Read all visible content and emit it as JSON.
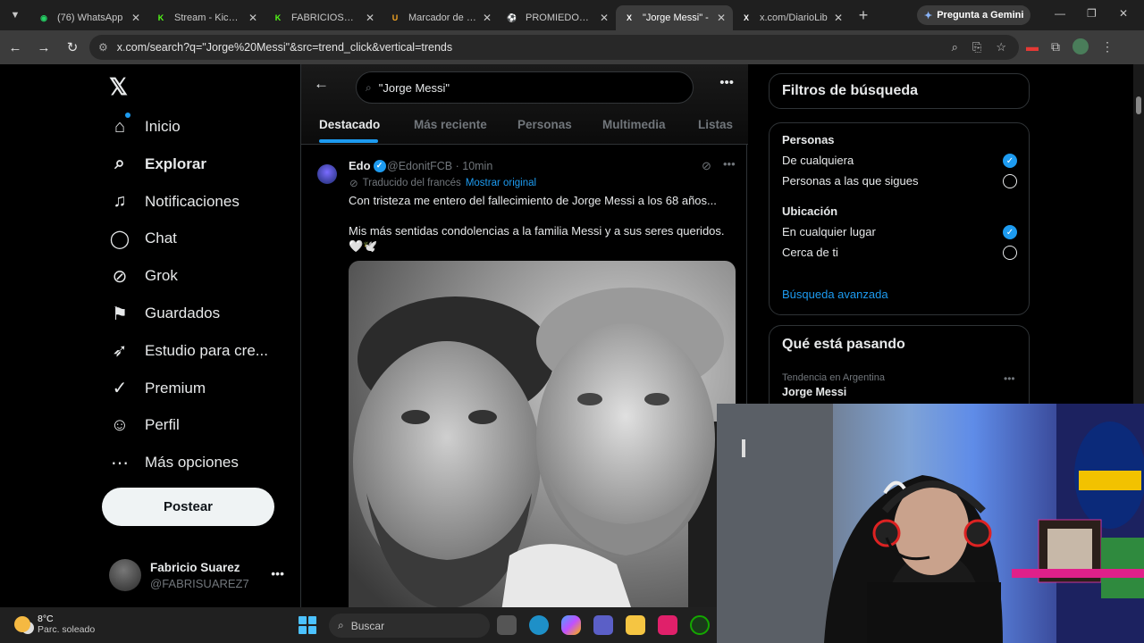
{
  "browser": {
    "tabs": [
      {
        "title": "(76) WhatsApp",
        "color": "#25d366",
        "glyph": "◉"
      },
      {
        "title": "Stream - Kick Da",
        "color": "#53fc18",
        "glyph": "K"
      },
      {
        "title": "FABRICIOSUARE",
        "color": "#53fc18",
        "glyph": "K"
      },
      {
        "title": "Marcador de lar",
        "color": "#f5a623",
        "glyph": "U"
      },
      {
        "title": "PROMIEDOS - F",
        "color": "#2ecc40",
        "glyph": "⚽"
      },
      {
        "title": "\"Jorge Messi\" - ",
        "color": "#ffffff",
        "glyph": "X"
      },
      {
        "title": "x.com/DiarioLib",
        "color": "#ffffff",
        "glyph": "X"
      }
    ],
    "gemini_label": "Pregunta a Gemini",
    "url": "x.com/search?q=\"Jorge%20Messi\"&src=trend_click&vertical=trends"
  },
  "sidebar": {
    "items": [
      {
        "label": "Inicio",
        "icon": "home-icon",
        "glyph": "⌂",
        "bold": false
      },
      {
        "label": "Explorar",
        "icon": "search-icon",
        "glyph": "⌕",
        "bold": true
      },
      {
        "label": "Notificaciones",
        "icon": "bell-icon",
        "glyph": "♫",
        "bold": false
      },
      {
        "label": "Chat",
        "icon": "chat-icon",
        "glyph": "◯",
        "bold": false
      },
      {
        "label": "Grok",
        "icon": "grok-icon",
        "glyph": "⊘",
        "bold": false
      },
      {
        "label": "Guardados",
        "icon": "bookmark-icon",
        "glyph": "⚑",
        "bold": false
      },
      {
        "label": "Estudio para cre...",
        "icon": "rocket-icon",
        "glyph": "➶",
        "bold": false
      },
      {
        "label": "Premium",
        "icon": "verified-icon",
        "glyph": "✓",
        "bold": false
      },
      {
        "label": "Perfil",
        "icon": "person-icon",
        "glyph": "☺",
        "bold": false
      },
      {
        "label": "Más opciones",
        "icon": "more-circle-icon",
        "glyph": "⋯",
        "bold": false
      }
    ],
    "post_label": "Postear",
    "account": {
      "name": "Fabricio Suarez",
      "handle": "@FABRISUAREZ7"
    }
  },
  "search": {
    "query": "\"Jorge Messi\""
  },
  "tabs": [
    "Destacado",
    "Más reciente",
    "Personas",
    "Multimedia",
    "Listas"
  ],
  "tweet": {
    "name": "Edo",
    "handle": "@EdonitFCB · 10min",
    "translated": "Traducido del francés",
    "show_original": "Mostrar original",
    "text1": "Con tristeza me entero del fallecimiento de Jorge Messi a los 68 años...",
    "text2": "Mis más sentidas condolencias a la familia Messi y a sus seres queridos. 🤍🕊️"
  },
  "filters": {
    "title": "Filtros de búsqueda",
    "people_heading": "Personas",
    "people_any": "De cualquiera",
    "people_follow": "Personas a las que sigues",
    "location_heading": "Ubicación",
    "location_any": "En cualquier lugar",
    "location_near": "Cerca de ti",
    "advanced": "Búsqueda avanzada"
  },
  "trending": {
    "title": "Qué está pasando",
    "meta": "Tendencia en Argentina",
    "name": "Jorge Messi"
  },
  "taskbar": {
    "temp": "8°C",
    "condition": "Parc. soleado",
    "search_placeholder": "Buscar"
  }
}
